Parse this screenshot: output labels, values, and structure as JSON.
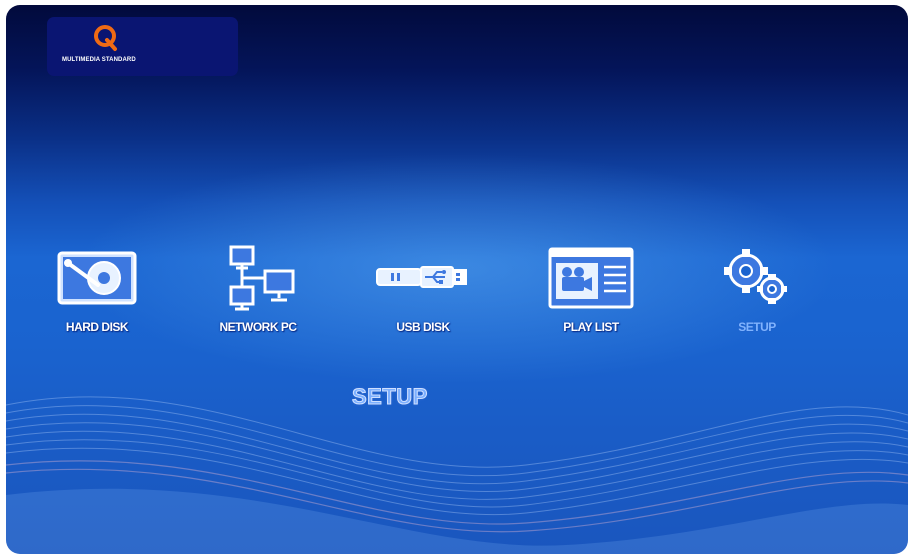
{
  "brand": {
    "logo_text": "MULTIMEDIA  STANDARD",
    "accent": "#f06a14"
  },
  "menu": {
    "items": [
      {
        "label": "HARD DISK",
        "icon": "hard-disk-icon",
        "selected": false
      },
      {
        "label": "NETWORK PC",
        "icon": "network-pc-icon",
        "selected": false
      },
      {
        "label": "USB  DISK",
        "icon": "usb-disk-icon",
        "selected": false
      },
      {
        "label": "PLAY  LIST",
        "icon": "playlist-icon",
        "selected": false
      },
      {
        "label": "SETUP",
        "icon": "gears-icon",
        "selected": true
      }
    ]
  },
  "section": {
    "title": "SETUP"
  },
  "colors": {
    "background": "#1a63cf",
    "selected_label": "#7fb4ff"
  }
}
